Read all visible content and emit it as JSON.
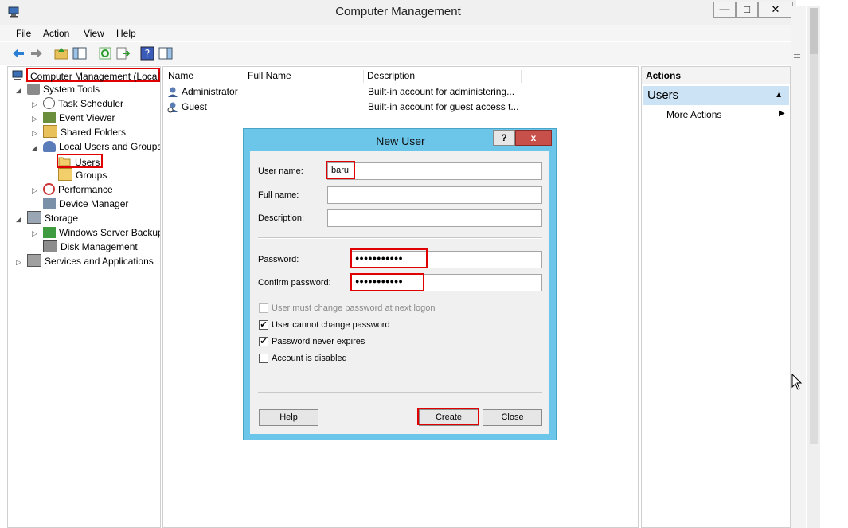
{
  "window": {
    "title": "Computer Management",
    "min_glyph": "—",
    "max_glyph": "□",
    "close_glyph": "✕"
  },
  "menu": [
    "File",
    "Action",
    "View",
    "Help"
  ],
  "tree": {
    "root": "Computer Management (Local)",
    "system_tools": "System Tools",
    "task_scheduler": "Task Scheduler",
    "event_viewer": "Event Viewer",
    "shared_folders": "Shared Folders",
    "local_users_groups": "Local Users and Groups",
    "users": "Users",
    "groups": "Groups",
    "performance": "Performance",
    "device_manager": "Device Manager",
    "storage": "Storage",
    "windows_server_backup": "Windows Server Backup",
    "disk_management": "Disk Management",
    "services_apps": "Services and Applications"
  },
  "list": {
    "columns": [
      "Name",
      "Full Name",
      "Description"
    ],
    "rows": [
      {
        "name": "Administrator",
        "full_name": "",
        "description": "Built-in account for administering..."
      },
      {
        "name": "Guest",
        "full_name": "",
        "description": "Built-in account for guest access t..."
      }
    ]
  },
  "actions": {
    "header": "Actions",
    "section": "Users",
    "more_actions": "More Actions"
  },
  "dialog": {
    "title": "New User",
    "help_glyph": "?",
    "close_glyph": "x",
    "username_label": "User name:",
    "username_value": "baru",
    "fullname_label": "Full name:",
    "fullname_value": "",
    "description_label": "Description:",
    "description_value": "",
    "password_label": "Password:",
    "password_value": "●●●●●●●●●●●",
    "confirm_label": "Confirm password:",
    "confirm_value": "●●●●●●●●●●●",
    "checkboxes": [
      {
        "label": "User must change password at next logon",
        "checked": false,
        "disabled": true
      },
      {
        "label": "User cannot change password",
        "checked": true,
        "disabled": false
      },
      {
        "label": "Password never expires",
        "checked": true,
        "disabled": false
      },
      {
        "label": "Account is disabled",
        "checked": false,
        "disabled": false
      }
    ],
    "help_button": "Help",
    "create_button": "Create",
    "close_button": "Close"
  },
  "colors": {
    "dialog_frame": "#6cc6ea",
    "close_red": "#c7504b",
    "highlight": "#e00000",
    "selection": "#cce3f6"
  }
}
